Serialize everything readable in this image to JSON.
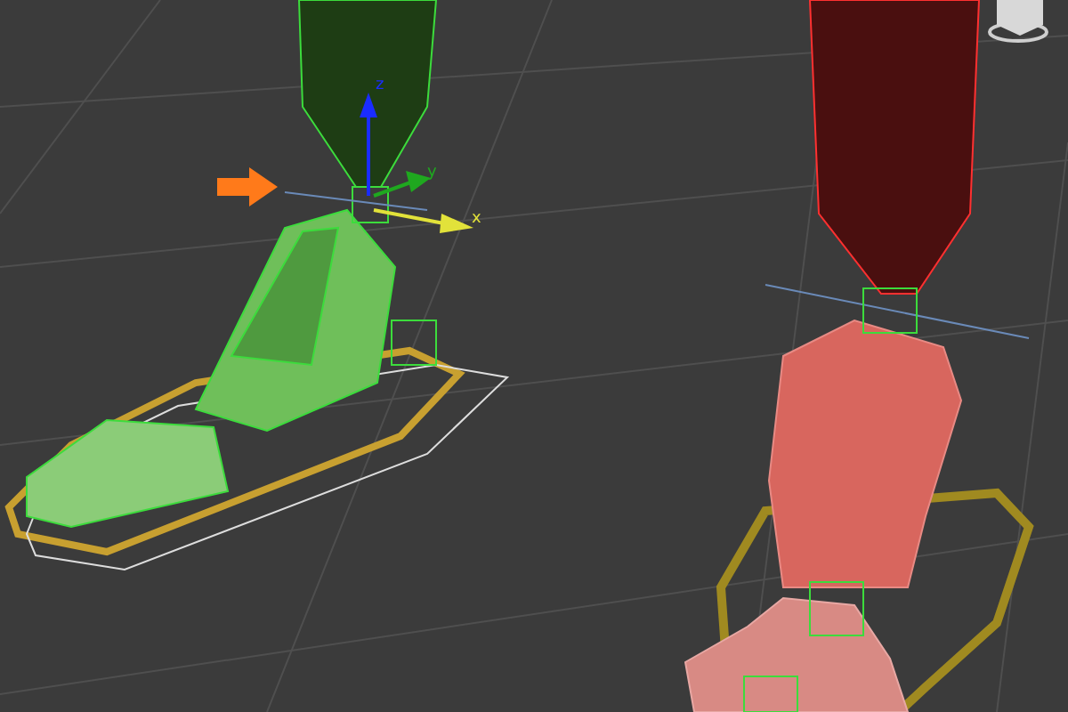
{
  "viewport": {
    "gizmo": {
      "axes": [
        {
          "label": "z",
          "color": "#1a2cff"
        },
        {
          "label": "y",
          "color": "#1fa81f"
        },
        {
          "label": "x",
          "color": "#e2e23a"
        }
      ]
    }
  }
}
